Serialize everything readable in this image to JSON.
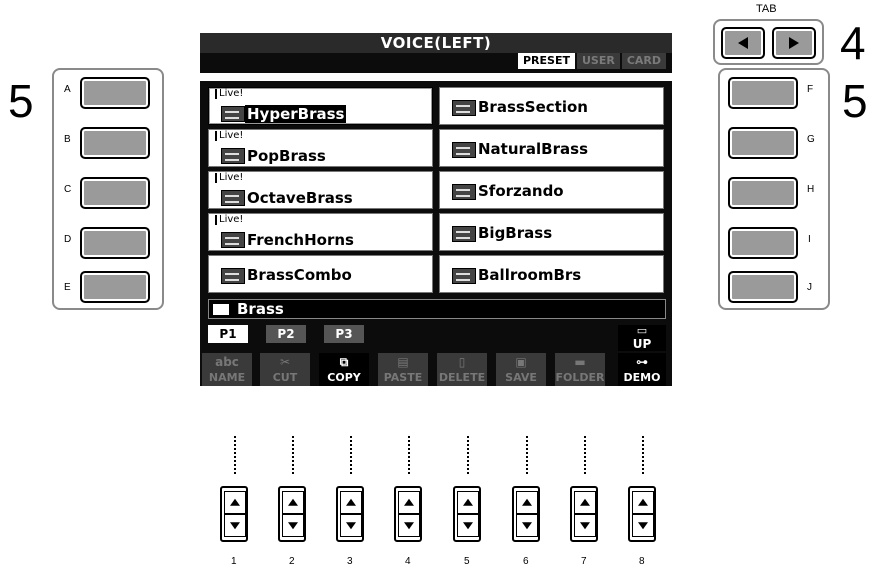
{
  "callouts": {
    "left": "5",
    "right": "5",
    "tab": "4"
  },
  "tab_label": "TAB",
  "left_buttons": [
    "A",
    "B",
    "C",
    "D",
    "E"
  ],
  "right_buttons": [
    "F",
    "G",
    "H",
    "I",
    "J"
  ],
  "screen": {
    "title": "VOICE(LEFT)",
    "sources": [
      "PRESET",
      "USER",
      "CARD"
    ],
    "live_tag": "Live!",
    "voices_left": [
      {
        "name": "HyperBrass",
        "live": true
      },
      {
        "name": "PopBrass",
        "live": true
      },
      {
        "name": "OctaveBrass",
        "live": true
      },
      {
        "name": "FrenchHorns",
        "live": true
      },
      {
        "name": "BrassCombo",
        "live": false
      }
    ],
    "voices_right": [
      "BrassSection",
      "NaturalBrass",
      "Sforzando",
      "BigBrass",
      "BallroomBrs"
    ],
    "bank": "Brass",
    "pages": [
      "P1",
      "P2",
      "P3"
    ],
    "up_label": "UP",
    "functions": [
      "NAME",
      "CUT",
      "COPY",
      "PASTE",
      "DELETE",
      "SAVE",
      "FOLDER",
      "DEMO"
    ]
  },
  "bottom_buttons": [
    "1",
    "2",
    "3",
    "4",
    "5",
    "6",
    "7",
    "8"
  ]
}
